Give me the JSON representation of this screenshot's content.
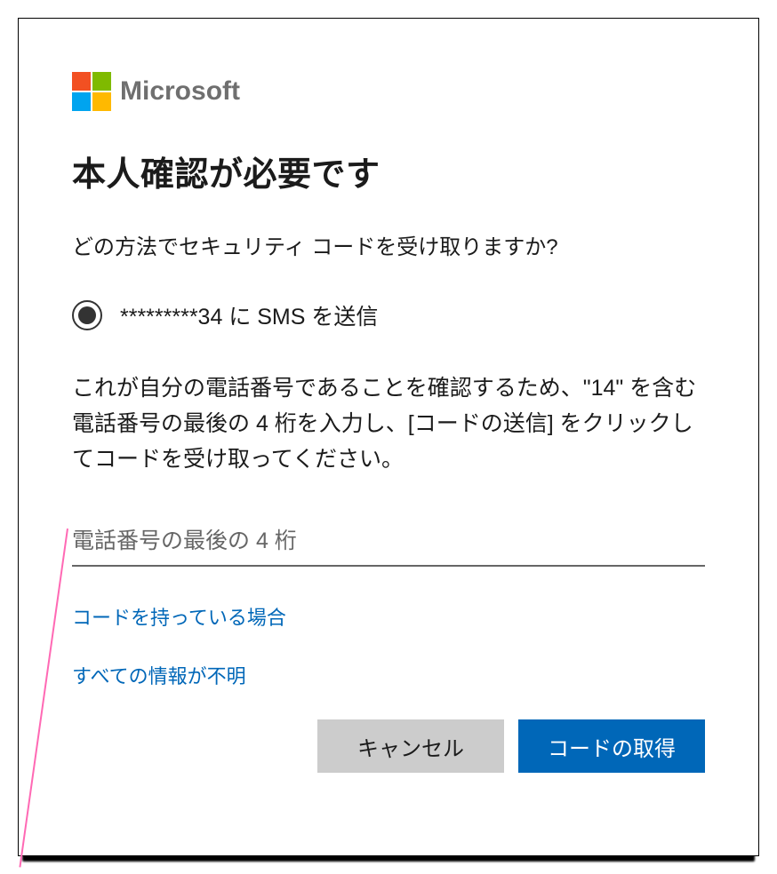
{
  "brand": {
    "name": "Microsoft"
  },
  "header": {
    "title": "本人確認が必要です",
    "subtitle": "どの方法でセキュリティ コードを受け取りますか?"
  },
  "verification": {
    "sms_option_label": "*********34 に SMS を送信",
    "instructions": "これが自分の電話番号であることを確認するため、\"14\" を含む電話番号の最後の 4 桁を入力し、[コードの送信] をクリックしてコードを受け取ってください。"
  },
  "input": {
    "placeholder": "電話番号の最後の 4 桁",
    "value": ""
  },
  "links": {
    "have_code": "コードを持っている場合",
    "no_info": "すべての情報が不明"
  },
  "buttons": {
    "cancel": "キャンセル",
    "get_code": "コードの取得"
  },
  "colors": {
    "primary": "#0067b8",
    "link": "#0067b8",
    "secondary_btn": "#cccccc",
    "annotation_line": "#ff69b4"
  }
}
